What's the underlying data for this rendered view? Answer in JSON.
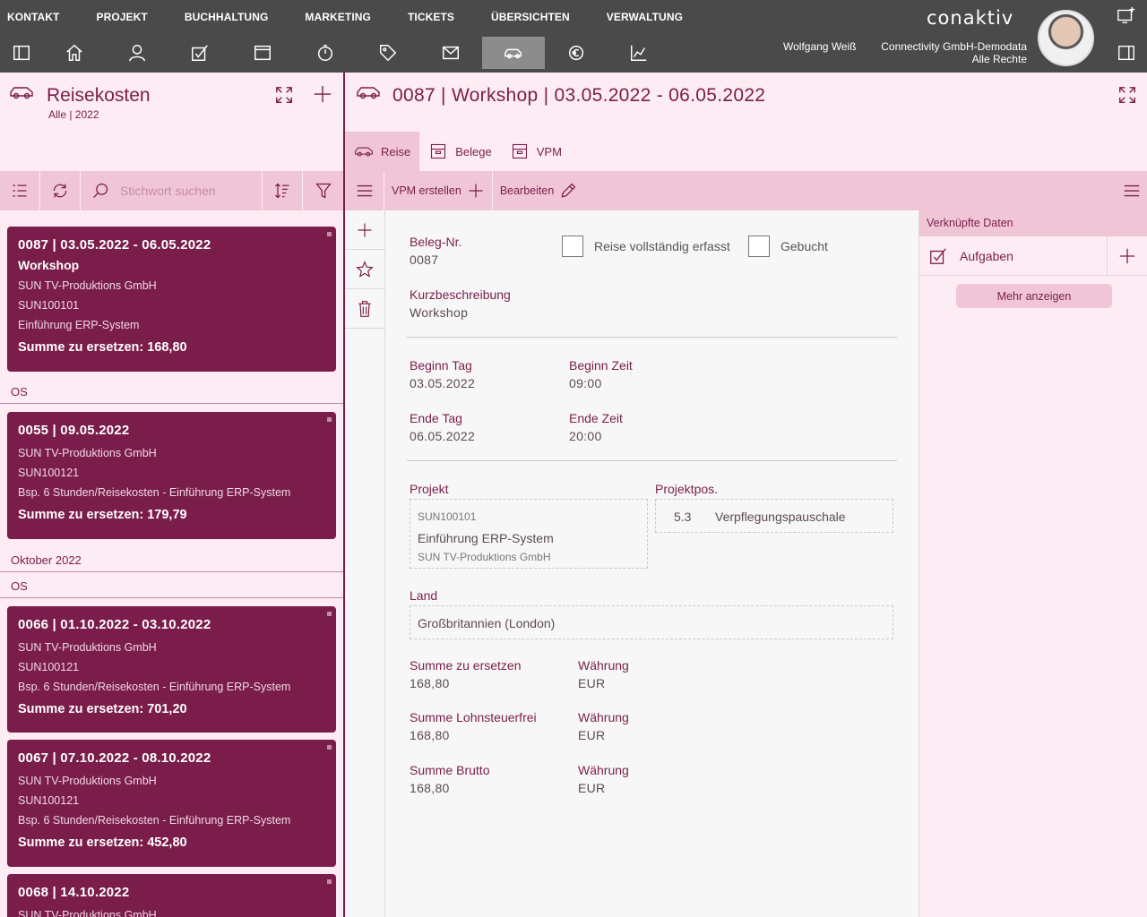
{
  "menu": [
    "KONTAKT",
    "PROJEKT",
    "BUCHHALTUNG",
    "MARKETING",
    "TICKETS",
    "ÜBERSICHTEN",
    "VERWALTUNG"
  ],
  "brand": "conaktiv",
  "user": {
    "name": "Wolfgang Weiß",
    "company": "Connectivity GmbH-Demodata",
    "rights": "Alle Rechte"
  },
  "toolbar_icons": [
    "sidebar-toggle-icon",
    "home-icon",
    "contact-icon",
    "tasks-icon",
    "window-icon",
    "timer-icon",
    "tag-icon",
    "mail-icon",
    "car-icon",
    "euro-gear-icon",
    "chart-icon"
  ],
  "left": {
    "title": "Reisekosten",
    "subtitle": "Alle | 2022",
    "search_placeholder": "Stichwort suchen"
  },
  "list": {
    "cards": [
      {
        "title": "0087 | 03.05.2022 - 06.05.2022",
        "subtitle": "Workshop",
        "lines": [
          "SUN TV-Produktions GmbH",
          "SUN100101",
          "Einführung ERP-System"
        ],
        "sum": "Summe zu ersetzen: 168,80"
      },
      {
        "title": "0055 | 09.05.2022",
        "subtitle": "",
        "lines": [
          "SUN TV-Produktions GmbH",
          "SUN100121",
          "Bsp. 6 Stunden/Reisekosten - Einführung ERP-System"
        ],
        "sum": "Summe zu ersetzen: 179,79"
      },
      {
        "title": "0066 | 01.10.2022 - 03.10.2022",
        "subtitle": "",
        "lines": [
          "SUN TV-Produktions GmbH",
          "SUN100121",
          "Bsp. 6 Stunden/Reisekosten - Einführung ERP-System"
        ],
        "sum": "Summe zu ersetzen: 701,20"
      },
      {
        "title": "0067 | 07.10.2022 - 08.10.2022",
        "subtitle": "",
        "lines": [
          "SUN TV-Produktions GmbH",
          "SUN100121",
          "Bsp. 6 Stunden/Reisekosten - Einführung ERP-System"
        ],
        "sum": "Summe zu ersetzen: 452,80"
      },
      {
        "title": "0068 | 14.10.2022",
        "subtitle": "",
        "lines": [
          "SUN TV-Produktions GmbH"
        ],
        "sum": ""
      }
    ],
    "groups": [
      "OS",
      "Oktober 2022",
      "OS"
    ]
  },
  "detail": {
    "title": "0087 | Workshop | 03.05.2022 - 06.05.2022",
    "tabs": [
      "Reise",
      "Belege",
      "VPM"
    ],
    "toolbar": {
      "vpm": "VPM erstellen",
      "edit": "Bearbeiten"
    },
    "beleg_label": "Beleg-Nr.",
    "beleg_value": "0087",
    "chk_complete": "Reise vollständig erfasst",
    "chk_booked": "Gebucht",
    "kurz_label": "Kurzbeschreibung",
    "kurz_value": "Workshop",
    "beginn_tag_label": "Beginn Tag",
    "beginn_tag": "03.05.2022",
    "beginn_zeit_label": "Beginn Zeit",
    "beginn_zeit": "09:00",
    "ende_tag_label": "Ende Tag",
    "ende_tag": "06.05.2022",
    "ende_zeit_label": "Ende Zeit",
    "ende_zeit": "20:00",
    "projekt_label": "Projekt",
    "projekt_nr": "SUN100101",
    "projekt_name": "Einführung ERP-System",
    "projekt_firma": "SUN TV-Produktions GmbH",
    "projektpos_label": "Projektpos.",
    "projektpos_nr": "5.3",
    "projektpos_name": "Verpflegungspauschale",
    "land_label": "Land",
    "land_value": "Großbritannien (London)",
    "summe1_label": "Summe zu ersetzen",
    "summe1": "168,80",
    "summe2_label": "Summe Lohnsteuerfrei",
    "summe2": "168,80",
    "summe3_label": "Summe Brutto",
    "summe3": "168,80",
    "waehrung_label": "Währung",
    "waehrung": "EUR"
  },
  "linked": {
    "header": "Verknüpfte Daten",
    "tasks": "Aufgaben",
    "more": "Mehr anzeigen"
  }
}
